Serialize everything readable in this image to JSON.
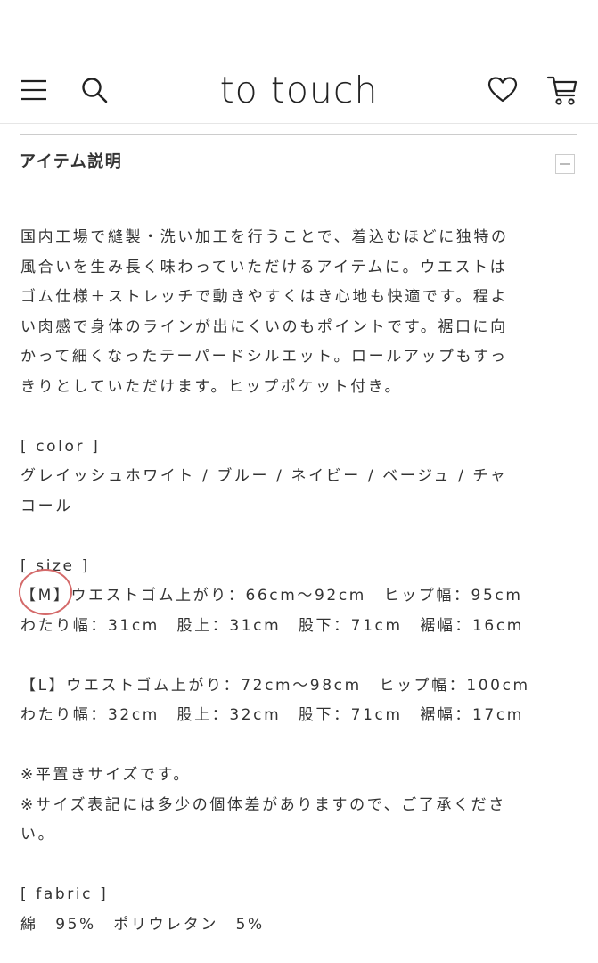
{
  "header": {
    "logo": "to touch",
    "icons": [
      "menu-icon",
      "search-icon",
      "heart-icon",
      "cart-icon"
    ]
  },
  "section": {
    "title": "アイテム説明",
    "toggle_icon": "minus-icon"
  },
  "description": {
    "intro": "国内工場で縫製・洗い加工を行うことで、着込むほどに独特の\n風合いを生み長く味わっていただけるアイテムに。ウエストは\nゴム仕様＋ストレッチで動きやすくはき心地も快適です。程よ\nい肉感で身体のラインが出にくいのもポイントです。裾口に向\nかって細くなったテーパードシルエット。ロールアップもすっ\nきりとしていただけます。ヒップポケット付き。",
    "color_heading": "[ color ]",
    "colors": "グレイッシュホワイト / ブルー / ネイビー / ベージュ / チャ\nコール",
    "size_heading": "[ size ]",
    "size_m": "【M】ウエストゴム上がり：66cm〜92cm　ヒップ幅：95cm\nわたり幅：31cm　股上：31cm　股下：71cm　裾幅：16cm",
    "size_l": "【L】ウエストゴム上がり：72cm〜98cm　ヒップ幅：100cm\nわたり幅：32cm　股上：32cm　股下：71cm　裾幅：17cm",
    "notes": "※平置きサイズです。\n※サイズ表記には多少の個体差がありますので、ご了承くださ\nい。",
    "fabric_heading": "[ fabric ]",
    "fabric": "綿　95%　ポリウレタン　5%"
  },
  "colors": {
    "text": "#333333",
    "rule": "#cccccc",
    "annotation": "#d46a6a"
  }
}
